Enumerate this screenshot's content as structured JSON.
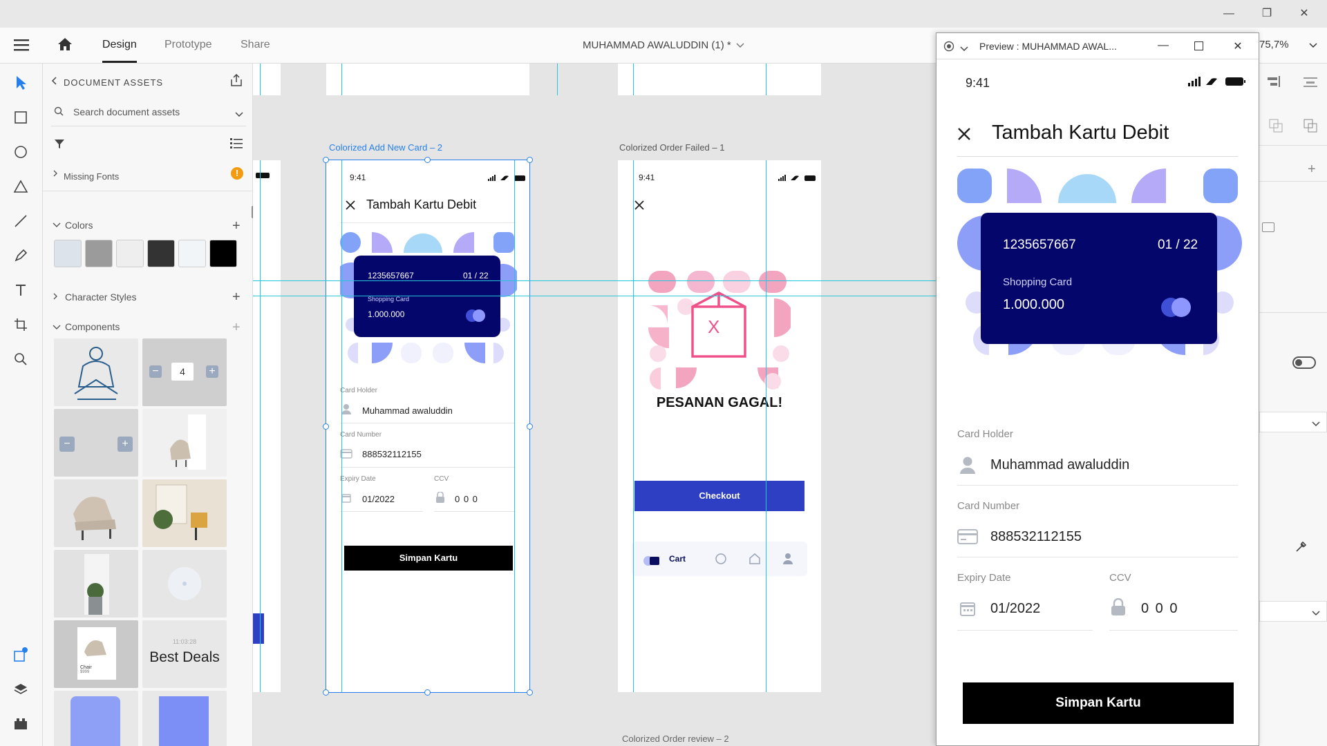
{
  "window": {
    "minimize": "—",
    "maximize": "❐",
    "close": "✕"
  },
  "toolbar": {
    "tabs": [
      "Design",
      "Prototype",
      "Share"
    ],
    "doc_title": "MUHAMMAD AWALUDDIN (1) *",
    "zoom": "75,7%"
  },
  "assets": {
    "title": "DOCUMENT ASSETS",
    "search_placeholder": "Search document assets",
    "missing_fonts": "Missing Fonts",
    "colors_label": "Colors",
    "swatches": [
      "#dde3ea",
      "#9b9b9b",
      "#eeeeee",
      "#333333",
      "#f2f5f8",
      "#000000"
    ],
    "character_styles": "Character Styles",
    "components": "Components",
    "stepper_value": "4",
    "thumb_time": "11:03:28",
    "best_deals": "Best Deals",
    "chair_label": "Chair",
    "chair_price": "$999"
  },
  "canvas": {
    "label_add_card": "Colorized Add New Card – 2",
    "label_order_failed": "Colorized Order Failed – 1",
    "label_bottom": "Colorized Order review – 2"
  },
  "phone": {
    "time": "9:41",
    "title": "Tambah Kartu Debit",
    "card_number": "1235657667",
    "card_expiry": "01 / 22",
    "card_type": "Shopping Card",
    "card_balance": "1.000.000",
    "card_holder_label": "Card Holder",
    "card_holder_value": "Muhammad awaluddin",
    "card_number_label": "Card Number",
    "card_number_value": "888532112155",
    "expiry_label": "Expiry Date",
    "expiry_value": "01/2022",
    "ccv_label": "CCV",
    "ccv_value": "0 0 0",
    "save_button": "Simpan Kartu"
  },
  "order_failed": {
    "time": "9:41",
    "message": "PESANAN GAGAL!",
    "box_mark": "X",
    "checkout": "Checkout",
    "cart": "Cart"
  },
  "preview": {
    "title": "Preview : MUHAMMAD AWAL..."
  },
  "colors": {
    "accent_blue": "#2f3fc4",
    "card_navy": "#05066b",
    "guide_cyan": "#26c6da",
    "select_blue": "#2680eb",
    "warning_orange": "#f39c12",
    "pink": "#f0508a"
  }
}
